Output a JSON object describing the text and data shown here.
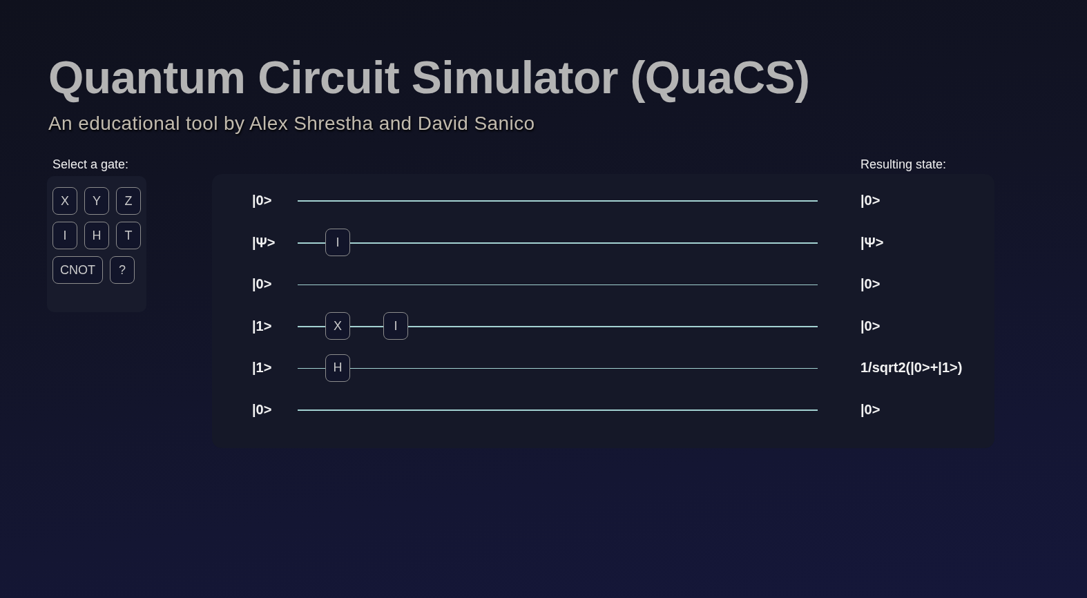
{
  "header": {
    "title": "Quantum Circuit Simulator (QuaCS)",
    "subtitle": "An educational tool by Alex Shrestha and David Sanico"
  },
  "gate_palette": {
    "label": "Select a gate:",
    "gates": [
      "X",
      "Y",
      "Z",
      "I",
      "H",
      "T",
      "CNOT",
      "?"
    ]
  },
  "circuit": {
    "result_label": "Resulting state:",
    "qubits": [
      {
        "input": "|0>",
        "output": "|0>"
      },
      {
        "input": "|Ψ>",
        "gates": [
          {
            "label": "I"
          }
        ],
        "output": "|Ψ>"
      },
      {
        "input": "|0>",
        "output": "|0>"
      },
      {
        "input": "|1>",
        "gates": [
          {
            "label": "X"
          },
          {
            "label": "I"
          }
        ],
        "output": "|0>"
      },
      {
        "input": "|1>",
        "gates": [
          {
            "label": "H"
          }
        ],
        "output": "1/sqrt2(|0>+|1>)"
      },
      {
        "input": "|0>",
        "output": "|0>"
      }
    ]
  }
}
